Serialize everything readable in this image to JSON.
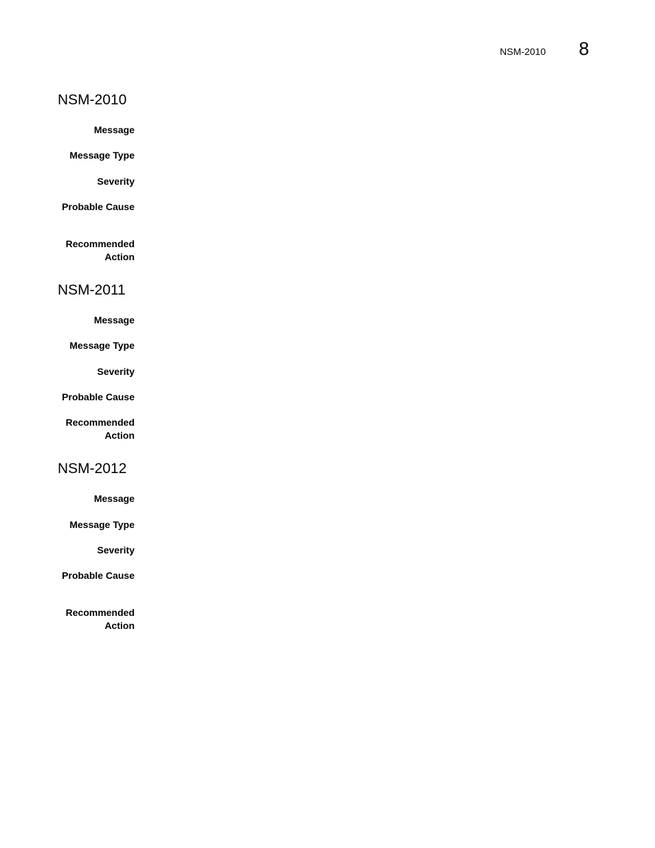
{
  "header": {
    "running_title": "NSM-2010",
    "chapter_number": "8"
  },
  "entries": [
    {
      "title": "NSM-2010",
      "fields": [
        {
          "label": "Message",
          "value": ""
        },
        {
          "label": "Message Type",
          "value": ""
        },
        {
          "label": "Severity",
          "value": ""
        },
        {
          "label": "Probable Cause",
          "value": ""
        },
        {
          "label_line1": "Recommended",
          "label_line2": "Action",
          "value": ""
        }
      ]
    },
    {
      "title": "NSM-2011",
      "fields": [
        {
          "label": "Message",
          "value": ""
        },
        {
          "label": "Message Type",
          "value": ""
        },
        {
          "label": "Severity",
          "value": ""
        },
        {
          "label": "Probable Cause",
          "value": ""
        },
        {
          "label_line1": "Recommended",
          "label_line2": "Action",
          "value": ""
        }
      ]
    },
    {
      "title": "NSM-2012",
      "fields": [
        {
          "label": "Message",
          "value": ""
        },
        {
          "label": "Message Type",
          "value": ""
        },
        {
          "label": "Severity",
          "value": ""
        },
        {
          "label": "Probable Cause",
          "value": ""
        },
        {
          "label_line1": "Recommended",
          "label_line2": "Action",
          "value": ""
        }
      ]
    }
  ]
}
